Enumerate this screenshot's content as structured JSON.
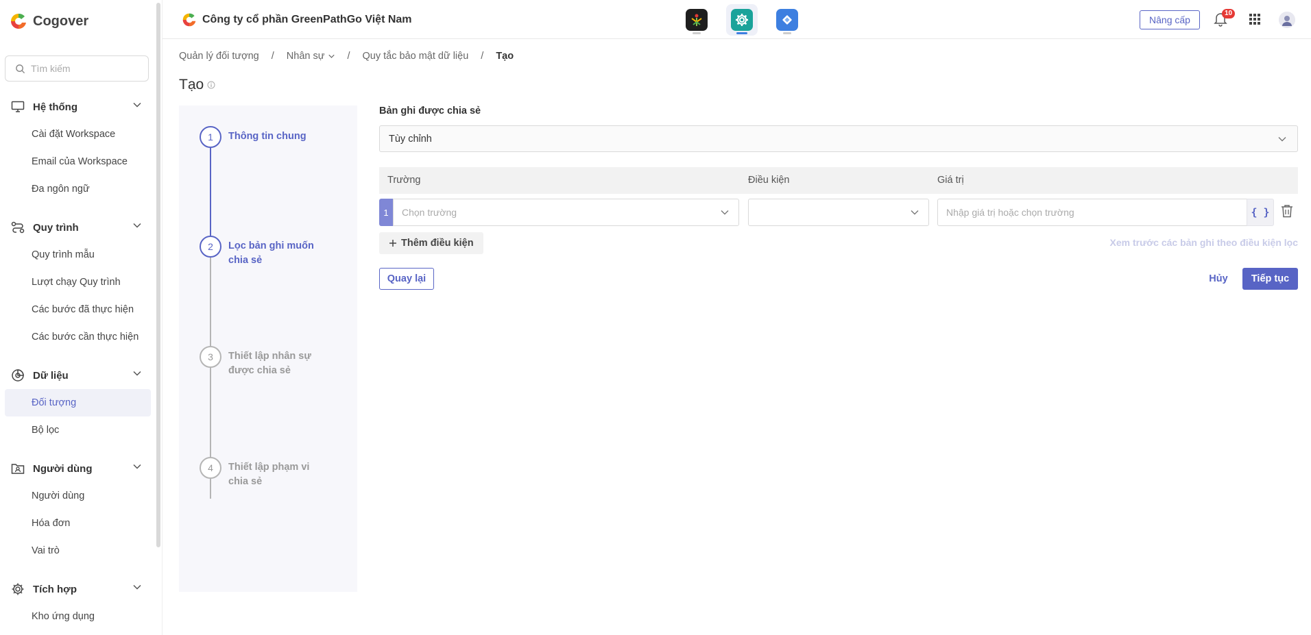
{
  "sidebar": {
    "brand": "Cogover",
    "search_placeholder": "Tìm kiếm",
    "groups": [
      {
        "title": "Hệ thống",
        "icon": "monitor-icon",
        "items": [
          "Cài đặt Workspace",
          "Email của Workspace",
          "Đa ngôn ngữ"
        ]
      },
      {
        "title": "Quy trình",
        "icon": "workflow-icon",
        "items": [
          "Quy trình mẫu",
          "Lượt chạy Quy trình",
          "Các bước đã thực hiện",
          "Các bước cần thực hiện"
        ]
      },
      {
        "title": "Dữ liệu",
        "icon": "data-icon",
        "items": [
          "Đối tượng",
          "Bộ lọc"
        ],
        "active": "Đối tượng"
      },
      {
        "title": "Người dùng",
        "icon": "users-folder-icon",
        "items": [
          "Người dùng",
          "Hóa đơn",
          "Vai trò"
        ]
      },
      {
        "title": "Tích hợp",
        "icon": "integration-gear-icon",
        "items": [
          "Kho ứng dụng"
        ]
      }
    ]
  },
  "topbar": {
    "company": "Công ty cổ phần GreenPathGo Việt Nam",
    "apps": [
      "people-app-icon",
      "settings-app-icon",
      "flow-app-icon"
    ],
    "upgrade_label": "Nâng cấp",
    "notification_count": "10"
  },
  "breadcrumb": {
    "items": [
      "Quản lý đối tượng",
      "Nhân sự",
      "Quy tắc bảo mật dữ liệu"
    ],
    "current": "Tạo"
  },
  "page_title": "Tạo",
  "steps": [
    {
      "num": "1",
      "label": "Thông tin chung",
      "state": "done"
    },
    {
      "num": "2",
      "label": "Lọc bản ghi muốn chia sẻ",
      "state": "active"
    },
    {
      "num": "3",
      "label": "Thiết lập nhân sự được chia sẻ",
      "state": "todo"
    },
    {
      "num": "4",
      "label": "Thiết lập phạm vi chia sẻ",
      "state": "todo"
    }
  ],
  "form": {
    "shared_records_label": "Bản ghi được chia sẻ",
    "shared_records_value": "Tùy chỉnh",
    "table_headers": {
      "field": "Trường",
      "condition": "Điều kiện",
      "value": "Giá trị"
    },
    "row": {
      "num": "1",
      "field_placeholder": "Chọn trường",
      "condition_value": "",
      "value_placeholder": "Nhập giá trị hoặc chọn trường",
      "braces": "{ }"
    },
    "add_condition_label": "Thêm điều kiện",
    "preview_link": "Xem trước các bản ghi theo điều kiện lọc",
    "back_label": "Quay lại",
    "cancel_label": "Hủy",
    "next_label": "Tiếp tục"
  },
  "colors": {
    "accent": "#5864c5",
    "accent_light": "#7f87d6"
  }
}
